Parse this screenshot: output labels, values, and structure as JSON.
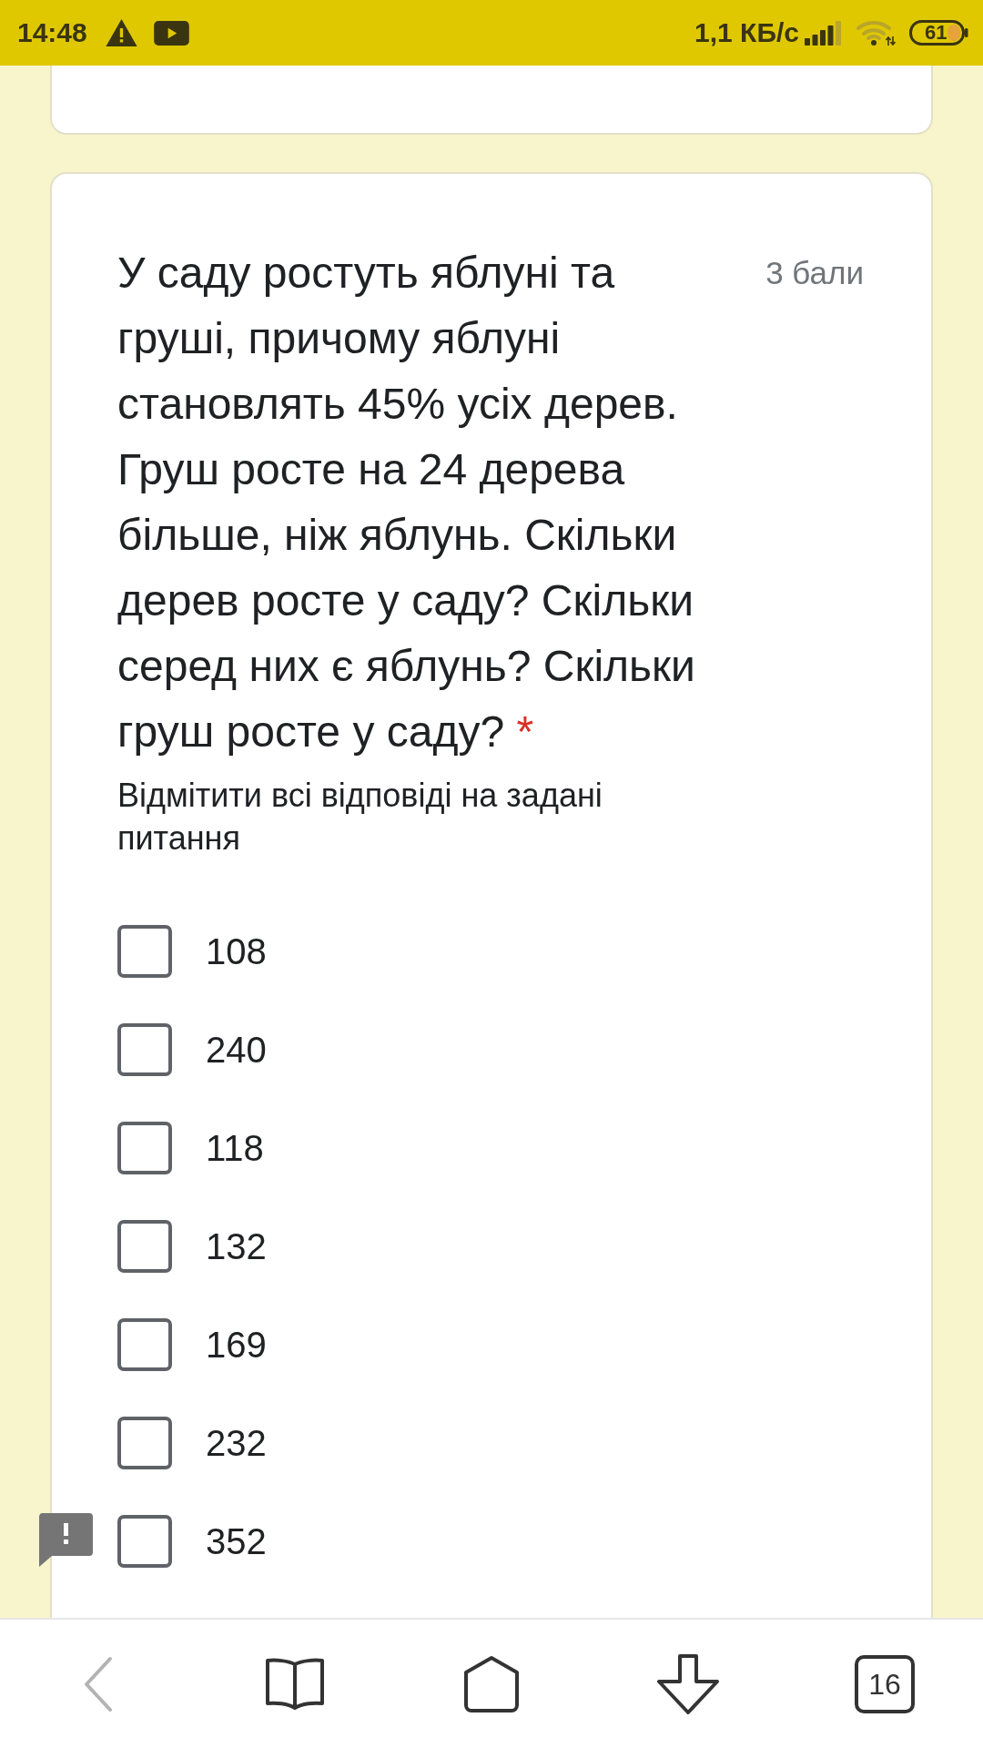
{
  "status_bar": {
    "time": "14:48",
    "network_speed": "1,1 КБ/с",
    "battery": "61"
  },
  "question": {
    "title": "У саду ростуть яблуні та груші, причому яблуні становлять 45% усіх дерев. Груш росте на 24 дерева більше, ніж яблунь. Скільки дерев росте у саду? Скільки серед них є яблунь? Скільки груш росте у саду?",
    "required": true,
    "required_mark": "*",
    "points": "3 бали",
    "helper_text": "Відмітити всі відповіді на задані питання"
  },
  "options": [
    {
      "label": "108",
      "checked": false
    },
    {
      "label": "240",
      "checked": false
    },
    {
      "label": "118",
      "checked": false
    },
    {
      "label": "132",
      "checked": false
    },
    {
      "label": "169",
      "checked": false
    },
    {
      "label": "232",
      "checked": false
    },
    {
      "label": "352",
      "checked": false
    }
  ],
  "bottom_nav": {
    "back_disabled": true,
    "tabs_count": "16"
  }
}
